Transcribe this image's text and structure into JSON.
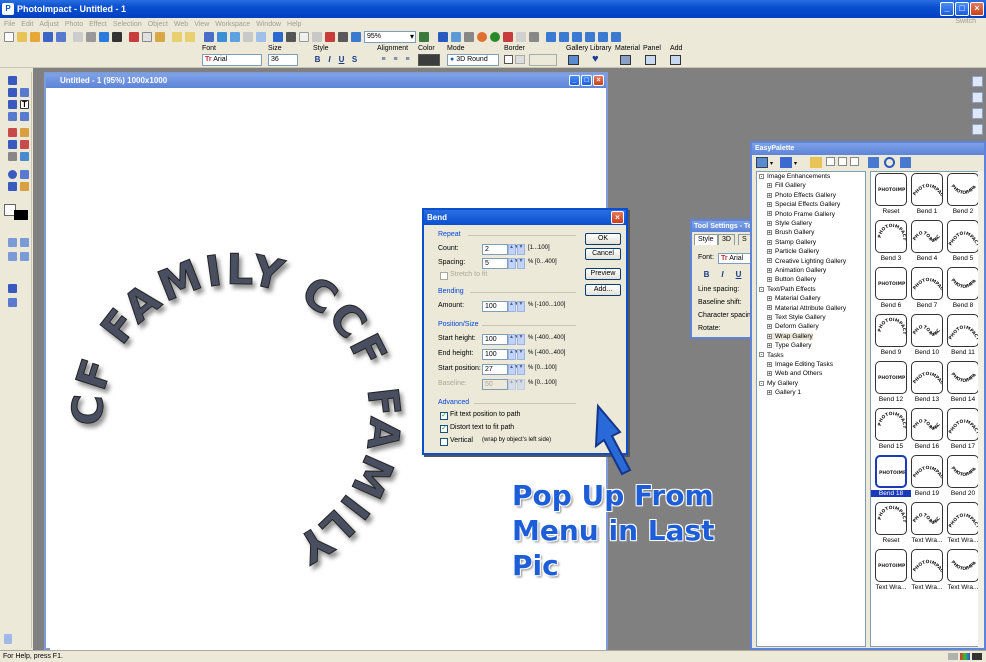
{
  "app": {
    "title": "PhotoImpact - Untitled - 1",
    "icon": "photoimpact-logo"
  },
  "menu": [
    "File",
    "Edit",
    "Adjust",
    "Photo",
    "Effect",
    "Selection",
    "Object",
    "Web",
    "View",
    "Workspace",
    "Window",
    "Help"
  ],
  "menu_right": "Switch",
  "toolbar": {
    "zoom": "95%"
  },
  "attributes": {
    "font_label": "Font",
    "font_value": "Arial",
    "size_label": "Size",
    "size_value": "36",
    "style_label": "Style",
    "style_buttons": [
      "B",
      "I",
      "U",
      "S"
    ],
    "alignment_label": "Alignment",
    "color_label": "Color",
    "color_value": "#3c3c3c",
    "mode_label": "Mode",
    "mode_value": "3D Round",
    "border_label": "Border",
    "gallery_label": "Gallery",
    "library_label": "Library",
    "material_label": "Material",
    "panel_label": "Panel",
    "add_label": "Add"
  },
  "document": {
    "title": "Untitled - 1 (95%) 1000x1000",
    "text": "CCF FAMILY CCF FAMILY"
  },
  "bend_dialog": {
    "title": "Bend",
    "repeat": {
      "label": "Repeat",
      "count_label": "Count:",
      "count": "2",
      "count_range": "[1...100]",
      "spacing_label": "Spacing:",
      "spacing": "5",
      "spacing_range": "% [0...400]",
      "stretch_label": "Stretch to fit"
    },
    "bending": {
      "label": "Bending",
      "amount_label": "Amount:",
      "amount": "100",
      "amount_range": "% [-100...100]"
    },
    "position": {
      "label": "Position/Size",
      "start_height_label": "Start height:",
      "start_height": "100",
      "start_height_range": "% [-400...400]",
      "end_height_label": "End height:",
      "end_height": "100",
      "end_height_range": "% [-400...400]",
      "start_position_label": "Start position:",
      "start_position": "27",
      "start_position_range": "% [0...100]",
      "baseline_label": "Baseline:",
      "baseline": "50",
      "baseline_range": "% [0...100]"
    },
    "advanced": {
      "label": "Advanced",
      "fit_label": "Fit text position to path",
      "distort_label": "Distort text to fit path",
      "vertical_label": "Vertical",
      "vertical_note": "(wrap by object's left side)"
    },
    "buttons": {
      "ok": "OK",
      "cancel": "Cancel",
      "preview": "Preview",
      "add": "Add..."
    }
  },
  "caption": "Pop Up From Menu in Last Pic",
  "tool_settings": {
    "title": "Tool Settings - Te",
    "tabs": [
      "Style",
      "3D",
      "S"
    ],
    "font_label": "Font:",
    "font_value": "Arial",
    "line_spacing": "Line spacing:",
    "baseline_shift": "Baseline shift:",
    "char_spacing": "Character spacing:",
    "rotate": "Rotate:"
  },
  "easy_palette": {
    "title": "EasyPalette",
    "tree": [
      {
        "label": "Image Enhancements",
        "level": 0,
        "expander": "-"
      },
      {
        "label": "Fill Gallery",
        "level": 1,
        "expander": "+"
      },
      {
        "label": "Photo Effects Gallery",
        "level": 1,
        "expander": "+"
      },
      {
        "label": "Special Effects Gallery",
        "level": 1,
        "expander": "+"
      },
      {
        "label": "Photo Frame Gallery",
        "level": 1,
        "expander": "+"
      },
      {
        "label": "Style Gallery",
        "level": 1,
        "expander": "+"
      },
      {
        "label": "Brush Gallery",
        "level": 1,
        "expander": "+"
      },
      {
        "label": "Stamp Gallery",
        "level": 1,
        "expander": "+"
      },
      {
        "label": "Particle Gallery",
        "level": 1,
        "expander": "+"
      },
      {
        "label": "Creative Lighting Gallery",
        "level": 1,
        "expander": "+"
      },
      {
        "label": "Animation Gallery",
        "level": 1,
        "expander": "+"
      },
      {
        "label": "Button Gallery",
        "level": 1,
        "expander": "+"
      },
      {
        "label": "Text/Path Effects",
        "level": 0,
        "expander": "-"
      },
      {
        "label": "Material Gallery",
        "level": 1,
        "expander": "+"
      },
      {
        "label": "Material Attribute Gallery",
        "level": 1,
        "expander": "+"
      },
      {
        "label": "Text Style Gallery",
        "level": 1,
        "expander": "+"
      },
      {
        "label": "Deform Gallery",
        "level": 1,
        "expander": "+"
      },
      {
        "label": "Wrap Gallery",
        "level": 1,
        "expander": "+",
        "selected": true
      },
      {
        "label": "Type Gallery",
        "level": 1,
        "expander": "+"
      },
      {
        "label": "Tasks",
        "level": 0,
        "expander": "-"
      },
      {
        "label": "Image Editing Tasks",
        "level": 1,
        "expander": "+"
      },
      {
        "label": "Web and Others",
        "level": 1,
        "expander": "+"
      },
      {
        "label": "My Gallery",
        "level": 0,
        "expander": "-"
      },
      {
        "label": "Gallery 1",
        "level": 1,
        "expander": "+"
      }
    ],
    "thumb_text": "PHOTOIMPACT",
    "thumbs": [
      "Reset",
      "Bend 1",
      "Bend 2",
      "Bend 3",
      "Bend 4",
      "Bend 5",
      "Bend 6",
      "Bend 7",
      "Bend 8",
      "Bend 9",
      "Bend 10",
      "Bend 11",
      "Bend 12",
      "Bend 13",
      "Bend 14",
      "Bend 15",
      "Bend 16",
      "Bend 17",
      "Bend 18",
      "Bend 19",
      "Bend 20",
      "Reset",
      "Text Wra...",
      "Text Wra...",
      "Text Wra...",
      "Text Wra...",
      "Text Wra..."
    ],
    "selected_thumb": "Bend 18"
  },
  "status": {
    "text": "For Help, press F1."
  }
}
